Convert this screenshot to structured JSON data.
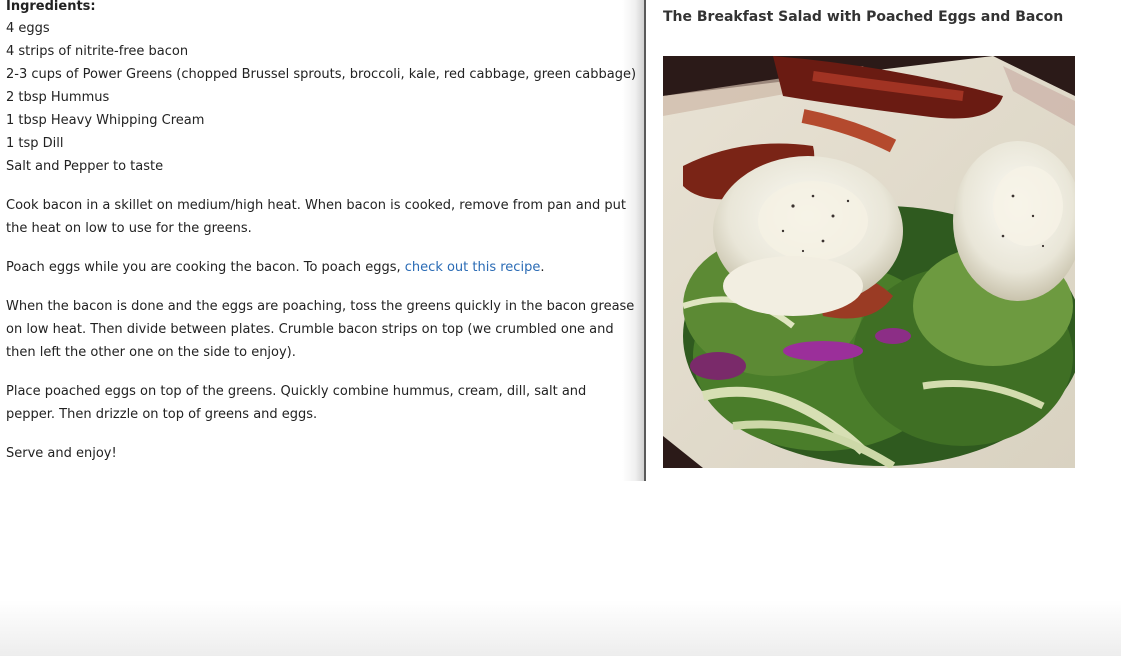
{
  "recipe": {
    "ingredients_heading": "Ingredients:",
    "ingredients": [
      "4 eggs",
      "4 strips of nitrite-free bacon",
      "2-3 cups of Power Greens (chopped Brussel sprouts, broccoli, kale, red cabbage, green cabbage)",
      "2 tbsp Hummus",
      "1 tbsp Heavy Whipping Cream",
      "1 tsp Dill",
      "Salt and Pepper to taste"
    ],
    "step1": "Cook bacon in a skillet on medium/high heat. When bacon is cooked, remove from pan and put the heat on low to use for the greens.",
    "step2_prefix": "Poach eggs while you are cooking the bacon. To poach eggs, ",
    "step2_link": "check out this recipe",
    "step2_suffix": ".",
    "step3": "When the bacon is done and the eggs are poaching, toss the greens quickly in the bacon grease on low heat. Then divide between plates. Crumble bacon strips on top (we crumbled one and then left the other one on the side to enjoy).",
    "step4": "Place poached eggs on top of the greens. Quickly combine hummus, cream, dill, salt and pepper. Then drizzle on top of greens and eggs.",
    "step5": "Serve and enjoy!"
  },
  "image_panel": {
    "title": "The Breakfast Salad with Poached Eggs and Bacon",
    "photo_subject": "breakfast-salad-photo"
  },
  "colors": {
    "link": "#2a6bb5",
    "text": "#222222",
    "divider": "#5a5a5a"
  }
}
